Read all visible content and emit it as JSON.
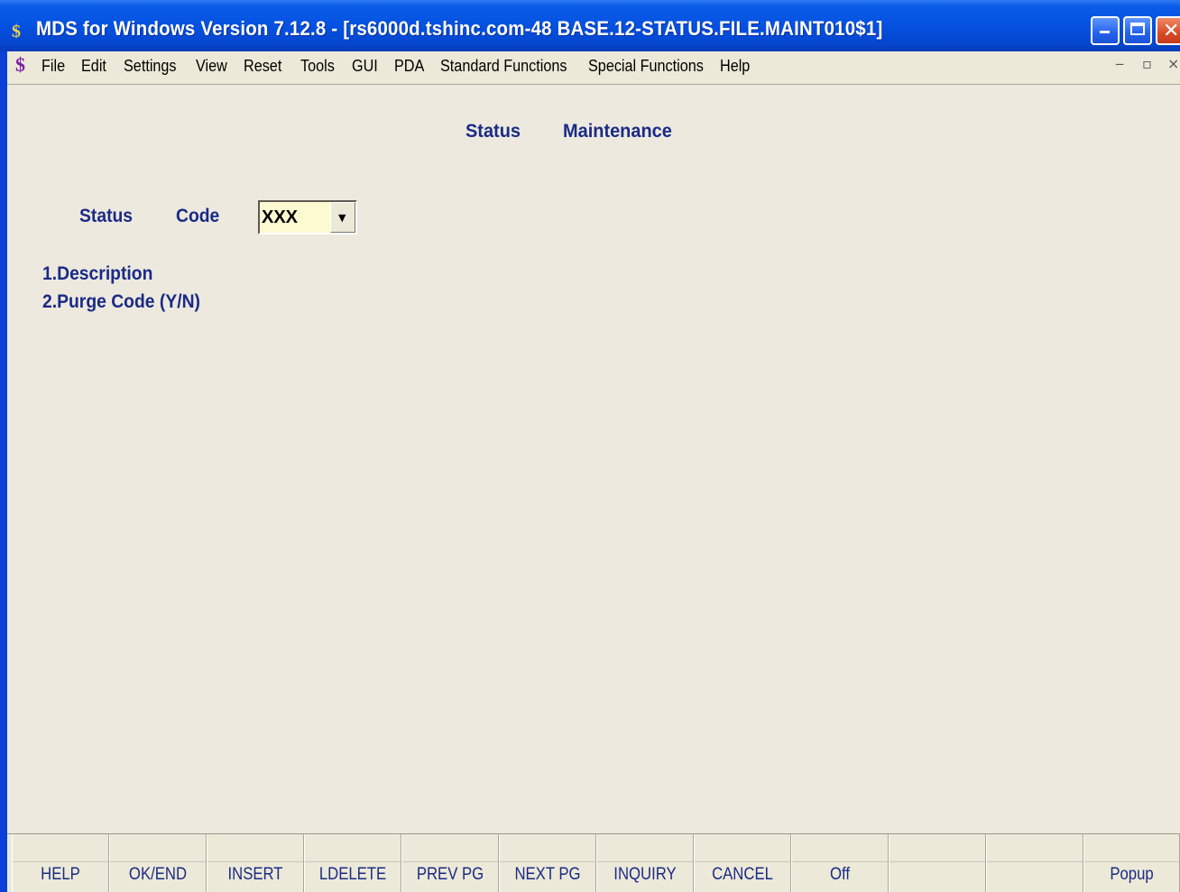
{
  "window": {
    "icon_glyph": "$",
    "title": "MDS for Windows Version 7.12.8 - [rs6000d.tshinc.com-48 BASE.12-STATUS.FILE.MAINT010$1]"
  },
  "menubar": {
    "logo_glyph": "$",
    "items": [
      "File",
      "Edit",
      "Settings",
      "View",
      "Reset",
      "Tools",
      "GUI",
      "PDA",
      "Standard Functions",
      "Special Functions",
      "Help"
    ],
    "mdi_min": "‒",
    "mdi_restore": "▫",
    "mdi_close": "×"
  },
  "form": {
    "heading_word1": "Status",
    "heading_word2": "Maintenance",
    "status_label": "Status",
    "code_label": "Code",
    "code_value": "XXX",
    "field1": "1.Description",
    "field2": "2.Purge Code (Y/N)"
  },
  "fkeys": [
    "HELP",
    "OK/END",
    "INSERT",
    "LDELETE",
    "PREV PG",
    "NEXT PG",
    "INQUIRY",
    "CANCEL",
    "Off",
    "",
    "",
    "Popup"
  ],
  "icons": {
    "app": "app-logo-icon",
    "dropdown": "chevron-down-icon"
  }
}
